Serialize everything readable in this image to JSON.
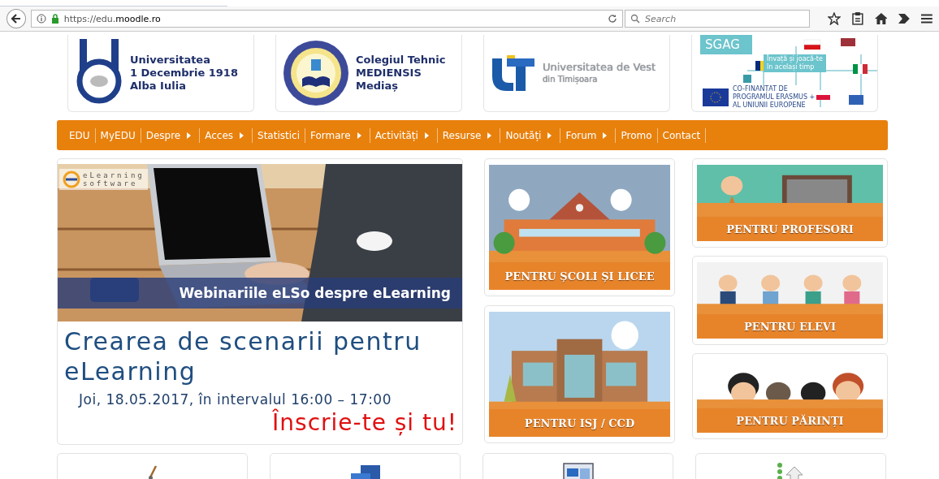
{
  "browser": {
    "url": "https://edu.**moodle.ro**",
    "search_placeholder": "Search"
  },
  "partners": [
    {
      "kind": "udec",
      "lines": [
        "Universitatea",
        "1 Decembrie 1918",
        "Alba Iulia"
      ]
    },
    {
      "kind": "seal",
      "lines": [
        "Colegiul Tehnic",
        "MEDIENSIS",
        "Mediaș"
      ]
    },
    {
      "kind": "uvt",
      "lines": [
        "Universitatea de Vest",
        "din Timișoara"
      ]
    },
    {
      "kind": "sgag",
      "lines": [
        "SGAG",
        "Învață și joacă-te",
        "în același timp",
        "CO-FINANȚAT DE",
        "PROGRAMUL ERASMUS +",
        "AL UNIUNII EUROPENE"
      ]
    }
  ],
  "nav": [
    {
      "label": "EDU",
      "submenu": false
    },
    {
      "label": "MyEDU",
      "submenu": false
    },
    {
      "label": "Despre",
      "submenu": true
    },
    {
      "label": "Acces",
      "submenu": true
    },
    {
      "label": "Statistici",
      "submenu": false
    },
    {
      "label": "Formare",
      "submenu": true
    },
    {
      "label": "Activități",
      "submenu": true
    },
    {
      "label": "Resurse",
      "submenu": true
    },
    {
      "label": "Noutăți",
      "submenu": true
    },
    {
      "label": "Forum",
      "submenu": true
    },
    {
      "label": "Promo",
      "submenu": false
    },
    {
      "label": "Contact",
      "submenu": false
    }
  ],
  "banner": {
    "logo": [
      "eLearning",
      "software"
    ],
    "strip": "Webinariile eLSo despre eLearning",
    "title": "Crearea de scenarii pentru eLearning",
    "date": "Joi, 18.05.2017, în intervalul 16:00 – 17:00",
    "cta": "Înscrie-te și tu!"
  },
  "tile_columns": [
    [
      {
        "kind": "school",
        "label": "PENTRU ȘCOLI ȘI LICEE"
      },
      {
        "kind": "isj",
        "label": "PENTRU ISJ / CCD"
      }
    ],
    [
      {
        "kind": "teacher",
        "label": "PENTRU PROFESORI"
      },
      {
        "kind": "students",
        "label": "PENTRU ELEVI"
      },
      {
        "kind": "parents",
        "label": "PENTRU PĂRINȚI"
      }
    ]
  ],
  "bottom_cards": [
    {
      "kind": "brush"
    },
    {
      "kind": "monitors"
    },
    {
      "kind": "window"
    },
    {
      "kind": "diagram"
    }
  ]
}
